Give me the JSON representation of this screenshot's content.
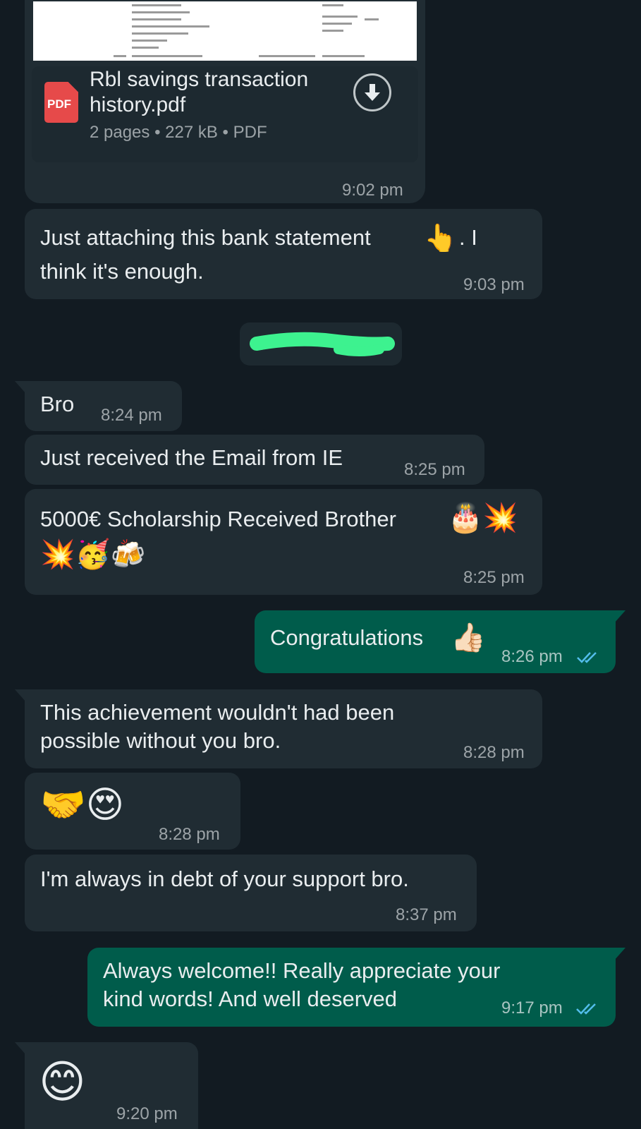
{
  "colors": {
    "background": "#121b22",
    "incoming_bubble": "#202c33",
    "outgoing_bubble": "#005c4b",
    "read_ticks": "#53bdeb",
    "pdf_red": "#e64a4a",
    "redaction": "#3df28f"
  },
  "attachment": {
    "pdf_badge": "PDF",
    "filename_line1": "Rbl savings transaction",
    "filename_line2": "history.pdf",
    "meta": "2 pages • 227 kB • PDF",
    "time": "9:02 pm",
    "download_icon": "download-arrow-icon"
  },
  "messages": [
    {
      "id": "m1",
      "dir": "in",
      "line1": "Just attaching this bank statement",
      "emoji": "👆",
      "line1_tail": ". I",
      "line2": "think it's enough.",
      "time": "9:03 pm"
    },
    {
      "id": "m2",
      "dir": "in",
      "text": "Bro",
      "time": "8:24 pm"
    },
    {
      "id": "m3",
      "dir": "in",
      "text": "Just received the Email from IE",
      "time": "8:25 pm"
    },
    {
      "id": "m4",
      "dir": "in",
      "text": "5000€ Scholarship Received Brother",
      "emoji_a": "🎂💥",
      "emoji_b": "💥🥳🍻",
      "time": "8:25 pm"
    },
    {
      "id": "m5",
      "dir": "out",
      "text": "Congratulations",
      "emoji": "👍🏻",
      "time": "8:26 pm",
      "status": "read"
    },
    {
      "id": "m6",
      "dir": "in",
      "line1": "This achievement wouldn't had been",
      "line2": "possible without you bro.",
      "time": "8:28 pm"
    },
    {
      "id": "m7",
      "dir": "in",
      "emoji": "🤝😍",
      "time": "8:28 pm"
    },
    {
      "id": "m8",
      "dir": "in",
      "text": "I'm always in debt of your support bro.",
      "time": "8:37 pm"
    },
    {
      "id": "m9",
      "dir": "out",
      "line1": "Always welcome!! Really appreciate your",
      "line2": "kind words! And well deserved",
      "time": "9:17 pm",
      "status": "read"
    },
    {
      "id": "m10",
      "dir": "in",
      "emoji": "😊",
      "time": "9:20 pm"
    }
  ]
}
